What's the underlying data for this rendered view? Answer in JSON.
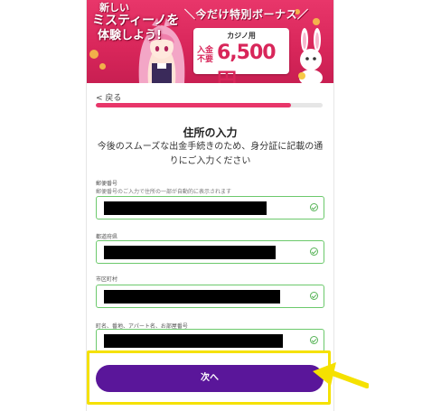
{
  "banner": {
    "new_label": "新しい",
    "headline_1": "ミスティーノを",
    "headline_2": "体験しよう!",
    "special_label": "＼今だけ特別ボーナス／",
    "bonus_caption": "カジノ用",
    "bonus_note": "入金不要",
    "bonus_amount": "6,500円",
    "colors": {
      "background": "#d8265a",
      "accent": "#f7c948"
    }
  },
  "nav": {
    "back_label": "< 戻る"
  },
  "progress": {
    "fraction": 0.86,
    "color": "#e8366a"
  },
  "form": {
    "title": "住所の入力",
    "intro": "今後のスムーズな出金手続きのため、身分証に記載の通りにご入力ください",
    "fields": [
      {
        "label": "郵便番号",
        "hint": "郵便番号のご入力で住所の一部が自動的に表示されます",
        "value": "",
        "status": "valid"
      },
      {
        "label": "都道府県",
        "value": "",
        "status": "valid"
      },
      {
        "label": "市区町村",
        "value": "",
        "status": "valid"
      },
      {
        "label": "町名、番地、アパート名、お部屋番号",
        "value": "",
        "status": "valid"
      }
    ]
  },
  "next_button": {
    "label": "次へ",
    "color": "#5a169a"
  },
  "annotation": {
    "highlight_color": "#f5e100",
    "arrow_icon": "arrow-left-icon"
  }
}
